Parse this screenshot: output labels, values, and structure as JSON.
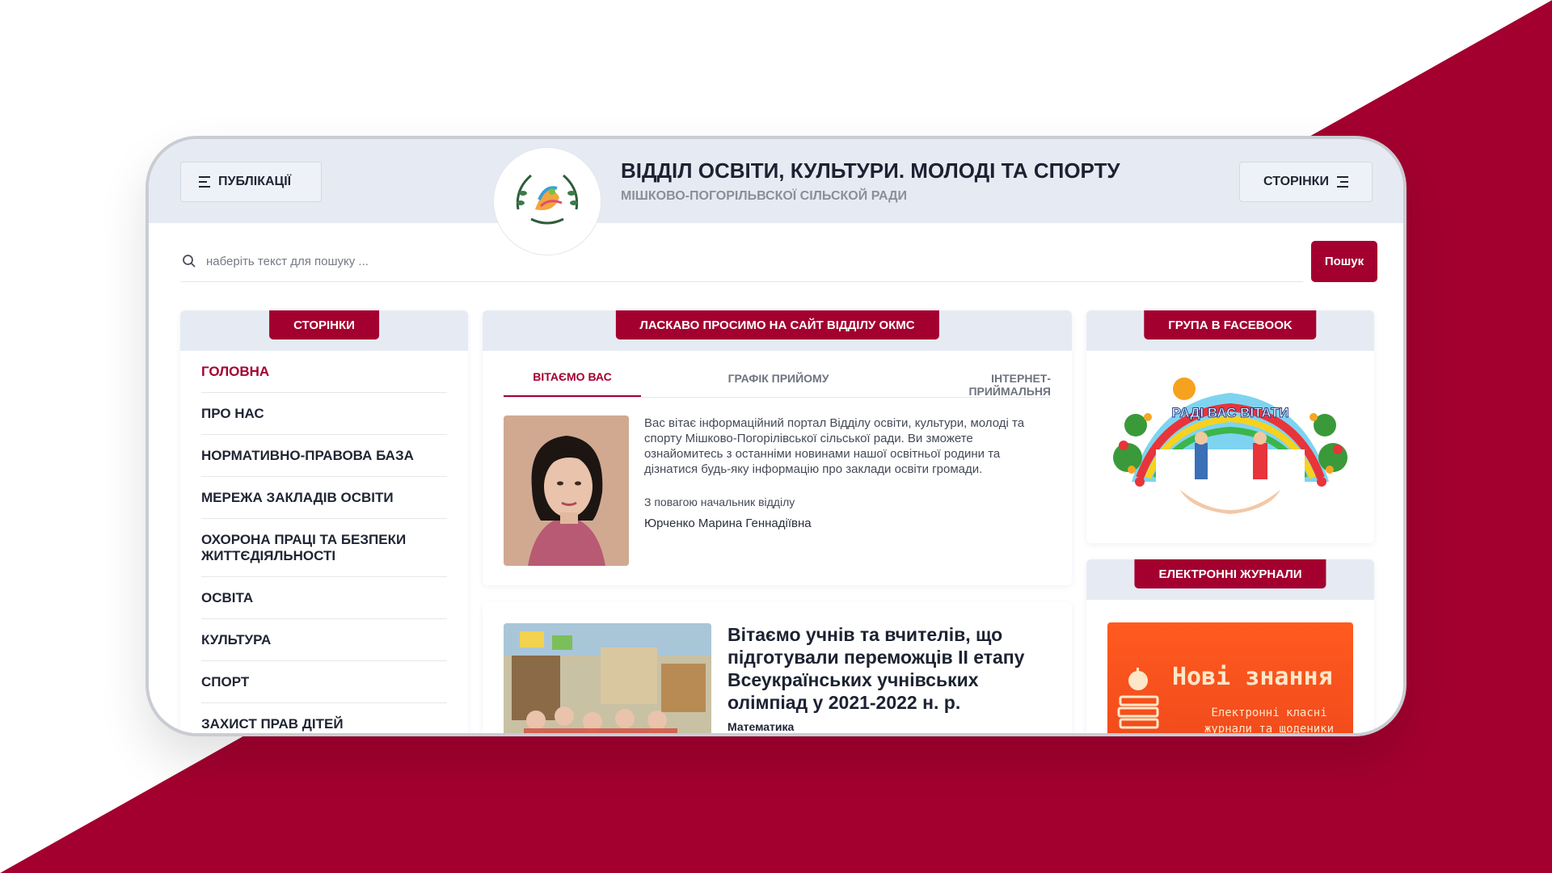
{
  "header": {
    "publications_label": "ПУБЛІКАЦІЇ",
    "pages_label": "СТОРІНКИ",
    "title": "ВІДДІЛ ОСВІТИ, КУЛЬТУРИ. МОЛОДІ ТА СПОРТУ",
    "subtitle": "МІШКОВО-ПОГОРІЛЬВСКОЇ СІЛЬСКОЙ РАДИ"
  },
  "search": {
    "placeholder": "наберіть текст для пошуку ...",
    "value": "",
    "button_label": "Пошук"
  },
  "sidebar": {
    "title": "СТОРІНКИ",
    "items": [
      {
        "label": "ГОЛОВНА"
      },
      {
        "label": "ПРО НАС"
      },
      {
        "label": "НОРМАТИВНО-ПРАВОВА БАЗА"
      },
      {
        "label": "МЕРЕЖА ЗАКЛАДІВ ОСВІТИ"
      },
      {
        "label": "ОХОРОНА ПРАЦІ ТА БЕЗПЕКИ ЖИТТЄДІЯЛЬНОСТІ"
      },
      {
        "label": "ОСВІТА"
      },
      {
        "label": "КУЛЬТУРА"
      },
      {
        "label": "СПОРТ"
      },
      {
        "label": "ЗАХИСТ ПРАВ ДІТЕЙ"
      }
    ]
  },
  "welcome": {
    "title": "ЛАСКАВО ПРОСИМО НА САЙТ ВІДДІЛУ ОКМС",
    "tabs": [
      "ВІТАЄМО ВАС",
      "ГРАФІК ПРИЙОМУ",
      "ІНТЕРНЕТ-ПРИЙМАЛЬНЯ"
    ],
    "text": "Вас вітає інформаційний портал Відділу освіти, культури, молоді та спорту Мішково-Погорілівської сільської ради. Ви зможете ознайомитесь з останніми новинами нашої освітньої родини та дізнатися будь-яку інформацію про заклади освіти громади.",
    "signature_line": "З повагою начальник відділу",
    "signature_name": "Юрченко Марина Геннадіївна"
  },
  "news": {
    "title": "Вітаємо учнів та вчителів, що підготували переможців ІІ етапу Всеукраїнських учнівських олімпіад у 2021-2022 н. р.",
    "category": "Математика"
  },
  "facebook": {
    "title": "ГРУПА В FACEBOOK",
    "image_text": "РАДІ ВАС ВІТАТИ"
  },
  "journals": {
    "title": "ЕЛЕКТРОННІ ЖУРНАЛИ",
    "name": "Нові знання",
    "subtitle": "Електронні класні журнали та щоденики"
  },
  "colors": {
    "accent": "#a3002f",
    "header_bg": "#e6ebf3",
    "journal_orange": "#ff5a1f"
  }
}
